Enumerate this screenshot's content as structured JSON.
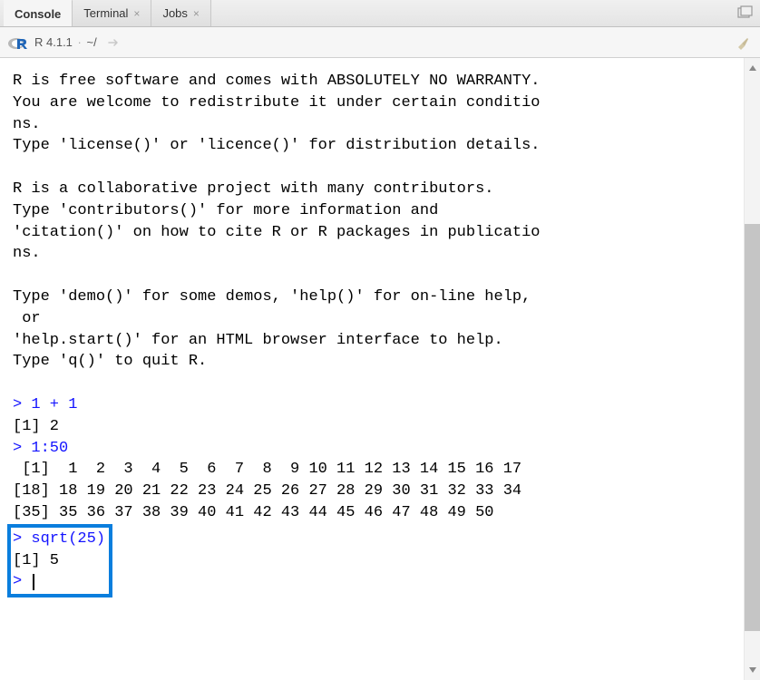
{
  "tabs": {
    "console": "Console",
    "terminal": "Terminal",
    "jobs": "Jobs"
  },
  "toolbar": {
    "version": "R 4.1.1",
    "path": "~/"
  },
  "console": {
    "line1": "R is free software and comes with ABSOLUTELY NO WARRANTY.",
    "line2": "You are welcome to redistribute it under certain conditio",
    "line3": "ns.",
    "line4": "Type 'license()' or 'licence()' for distribution details.",
    "line5": "",
    "line6": "R is a collaborative project with many contributors.",
    "line7": "Type 'contributors()' for more information and",
    "line8": "'citation()' on how to cite R or R packages in publicatio",
    "line9": "ns.",
    "line10": "",
    "line11": "Type 'demo()' for some demos, 'help()' for on-line help,",
    "line12": " or",
    "line13": "'help.start()' for an HTML browser interface to help.",
    "line14": "Type 'q()' to quit R.",
    "line15": "",
    "prompt1": "> ",
    "input1": "1 + 1",
    "output1": "[1] 2",
    "prompt2": "> ",
    "input2": "1:50",
    "output2a": " [1]  1  2  3  4  5  6  7  8  9 10 11 12 13 14 15 16 17",
    "output2b": "[18] 18 19 20 21 22 23 24 25 26 27 28 29 30 31 32 33 34",
    "output2c": "[35] 35 36 37 38 39 40 41 42 43 44 45 46 47 48 49 50",
    "hlprompt": "> ",
    "hlinput": "sqrt(25)",
    "hloutput": "[1] 5",
    "hlprompt2": "> "
  }
}
